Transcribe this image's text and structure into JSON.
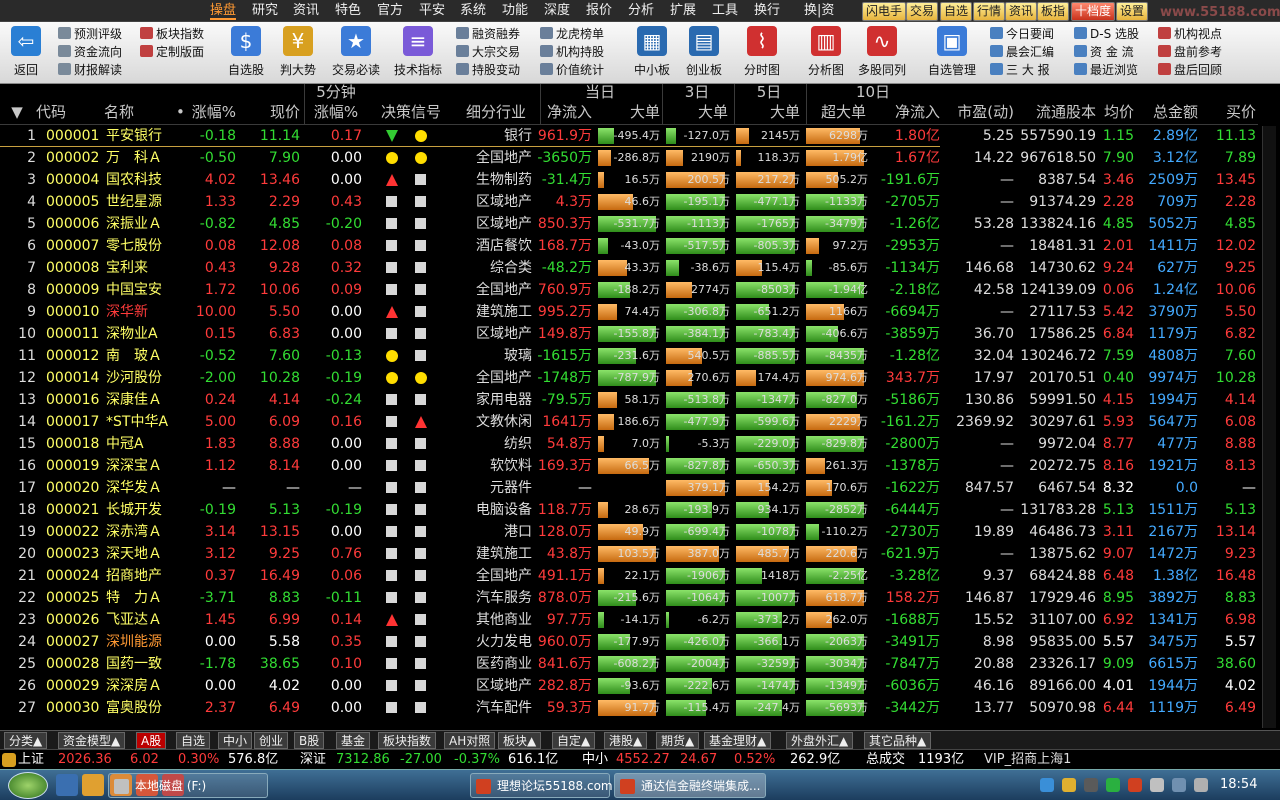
{
  "menu": {
    "items": [
      "操盘",
      "研究",
      "资讯",
      "特色",
      "官方",
      "平安",
      "系统",
      "功能",
      "深度",
      "报价",
      "分析",
      "扩展",
      "工具",
      "换行",
      "换|资"
    ],
    "active": 0,
    "right_buttons": [
      "闪电手",
      "交易",
      "自选",
      "行情",
      "资讯",
      "板指",
      "十档度",
      "设置"
    ]
  },
  "watermark": "www.55188.com",
  "toolbar": {
    "back": "返回",
    "small_groups": [
      [
        "预测评级",
        "资金流向",
        "财报解读"
      ],
      [
        "板块指数",
        "定制版面"
      ],
      [
        "融资融券",
        "大宗交易",
        "持股变动"
      ],
      [
        "龙虎榜单",
        "机构持股",
        "价值统计"
      ],
      [
        "今日要闻",
        "晨会汇编",
        "三 大 报"
      ],
      [
        "D-S 选股",
        "资 金 流",
        "最近浏览"
      ],
      [
        "机构视点",
        "盘前参考",
        "盘后回顾"
      ]
    ],
    "big": [
      "自选股",
      "判大势",
      "交易必读",
      "技术指标",
      "中小板",
      "创业板",
      "分时图",
      "分析图",
      "多股同列",
      "自选管理"
    ]
  },
  "headers": {
    "row1": {
      "today": "当日",
      "d3": "3日",
      "d5": "5日",
      "d10": "10日",
      "min5": "5分钟"
    },
    "row2": {
      "sel": "▼",
      "code": "代码",
      "name": "名称",
      "chg": "涨幅%",
      "price": "现价",
      "min5chg": "涨幅%",
      "signal": "决策信号",
      "industry": "细分行业",
      "netin": "净流入",
      "big1": "大单",
      "big3": "大单",
      "big5": "大单",
      "superbig": "超大单",
      "net10": "净流入",
      "pe": "市盈(动)",
      "float": "流通股本",
      "avgp": "均价",
      "amount": "总金额",
      "bid": "买价"
    },
    "name_dot": "•"
  },
  "colors": {
    "up": "#ff3b3b",
    "down": "#33dd33",
    "flat": "#ffffff",
    "code": "#ffff66",
    "name": "#ffff66",
    "blue": "#44aaff"
  },
  "rows": [
    {
      "n": "1",
      "code": "000001",
      "name": "平安银行",
      "chg": "-0.18",
      "price": "11.14",
      "m5": "0.17",
      "s1": "down",
      "s2": "dot",
      "ind": "银行",
      "net": "961.9万",
      "b1": "-495.4万",
      "b1v": 0.25,
      "b1c": "g",
      "b3": "-127.0万",
      "b3v": 0.15,
      "b3c": "g",
      "b5": "2145万",
      "b5v": 0.2,
      "b5c": "o",
      "sb": "6298万",
      "sbv": 0.85,
      "sbc": "o",
      "net10": "1.80亿",
      "pe": "5.25",
      "flt": "557590.19",
      "avg": "1.15",
      "amt": "2.89亿",
      "bid": "11.13"
    },
    {
      "n": "2",
      "code": "000002",
      "name": "万　科Ａ",
      "chg": "-0.50",
      "price": "7.90",
      "m5": "0.00",
      "s1": "dot",
      "s2": "dot",
      "ind": "全国地产",
      "net": "-3650万",
      "b1": "-286.8万",
      "b1v": 0.2,
      "b1c": "o",
      "b3": "2190万",
      "b3v": 0.25,
      "b3c": "o",
      "b5": "118.3万",
      "b5v": 0.08,
      "b5c": "o",
      "sb": "1.79亿",
      "sbv": 0.9,
      "sbc": "o",
      "net10": "1.67亿",
      "pe": "14.22",
      "flt": "967618.50",
      "avg": "7.90",
      "amt": "3.12亿",
      "bid": "7.89"
    },
    {
      "n": "3",
      "code": "000004",
      "name": "国农科技",
      "chg": "4.02",
      "price": "13.46",
      "m5": "0.00",
      "s1": "up",
      "s2": "sq",
      "ind": "生物制药",
      "net": "-31.4万",
      "b1": "16.5万",
      "b1v": 0.1,
      "b1c": "o",
      "b3": "200.5万",
      "b3v": 0.9,
      "b3c": "o",
      "b5": "217.2万",
      "b5v": 0.9,
      "b5c": "o",
      "sb": "505.2万",
      "sbv": 0.5,
      "sbc": "o",
      "net10": "-191.6万",
      "pe": "—",
      "flt": "8387.54",
      "avg": "3.46",
      "amt": "2509万",
      "bid": "13.45"
    },
    {
      "n": "4",
      "code": "000005",
      "name": "世纪星源",
      "chg": "1.33",
      "price": "2.29",
      "m5": "0.43",
      "s1": "sq",
      "s2": "sq",
      "ind": "区域地产",
      "net": "4.3万",
      "b1": "46.6万",
      "b1v": 0.55,
      "b1c": "o",
      "b3": "-195.1万",
      "b3v": 0.9,
      "b3c": "g",
      "b5": "-477.1万",
      "b5v": 0.9,
      "b5c": "g",
      "sb": "-1133万",
      "sbv": 0.9,
      "sbc": "g",
      "net10": "-2705万",
      "pe": "—",
      "flt": "91374.29",
      "avg": "2.28",
      "amt": "709万",
      "bid": "2.28"
    },
    {
      "n": "5",
      "code": "000006",
      "name": "深振业Ａ",
      "chg": "-0.82",
      "price": "4.85",
      "m5": "-0.20",
      "s1": "sq",
      "s2": "sq",
      "ind": "区域地产",
      "net": "850.3万",
      "b1": "-531.7万",
      "b1v": 0.9,
      "b1c": "g",
      "b3": "-1113万",
      "b3v": 0.9,
      "b3c": "g",
      "b5": "-1765万",
      "b5v": 0.9,
      "b5c": "g",
      "sb": "-3479万",
      "sbv": 0.9,
      "sbc": "g",
      "net10": "-1.26亿",
      "pe": "53.28",
      "flt": "133824.16",
      "avg": "4.85",
      "amt": "5052万",
      "bid": "4.85"
    },
    {
      "n": "6",
      "code": "000007",
      "name": "零七股份",
      "chg": "0.08",
      "price": "12.08",
      "m5": "0.08",
      "s1": "sq",
      "s2": "sq",
      "ind": "酒店餐饮",
      "net": "168.7万",
      "b1": "-43.0万",
      "b1v": 0.15,
      "b1c": "g",
      "b3": "-517.5万",
      "b3v": 0.9,
      "b3c": "g",
      "b5": "-805.3万",
      "b5v": 0.9,
      "b5c": "g",
      "sb": "97.2万",
      "sbv": 0.2,
      "sbc": "o",
      "net10": "-2953万",
      "pe": "—",
      "flt": "18481.31",
      "avg": "2.01",
      "amt": "1411万",
      "bid": "12.02"
    },
    {
      "n": "7",
      "code": "000008",
      "name": "宝利来",
      "chg": "0.43",
      "price": "9.28",
      "m5": "0.32",
      "s1": "sq",
      "s2": "sq",
      "ind": "综合类",
      "net": "-48.2万",
      "b1": "43.3万",
      "b1v": 0.45,
      "b1c": "o",
      "b3": "-38.6万",
      "b3v": 0.2,
      "b3c": "g",
      "b5": "115.4万",
      "b5v": 0.4,
      "b5c": "o",
      "sb": "-85.6万",
      "sbv": 0.1,
      "sbc": "g",
      "net10": "-1134万",
      "pe": "146.68",
      "flt": "14730.62",
      "avg": "9.24",
      "amt": "627万",
      "bid": "9.25"
    },
    {
      "n": "8",
      "code": "000009",
      "name": "中国宝安",
      "chg": "1.72",
      "price": "10.06",
      "m5": "0.09",
      "s1": "sq",
      "s2": "sq",
      "ind": "全国地产",
      "net": "760.9万",
      "b1": "-188.2万",
      "b1v": 0.5,
      "b1c": "g",
      "b3": "2774万",
      "b3v": 0.4,
      "b3c": "o",
      "b5": "-8503万",
      "b5v": 0.9,
      "b5c": "g",
      "sb": "-1.94亿",
      "sbv": 0.9,
      "sbc": "g",
      "net10": "-2.18亿",
      "pe": "42.58",
      "flt": "124139.09",
      "avg": "0.06",
      "amt": "1.24亿",
      "bid": "10.06"
    },
    {
      "n": "9",
      "code": "000010",
      "name": "深华新",
      "chg": "10.00",
      "price": "5.50",
      "m5": "0.00",
      "s1": "up",
      "s2": "sq",
      "ind": "建筑施工",
      "net": "995.2万",
      "b1": "74.4万",
      "b1v": 0.3,
      "b1c": "o",
      "b3": "-306.8万",
      "b3v": 0.9,
      "b3c": "g",
      "b5": "-651.2万",
      "b5v": 0.5,
      "b5c": "g",
      "sb": "1166万",
      "sbv": 0.6,
      "sbc": "o",
      "net10": "-6694万",
      "pe": "—",
      "flt": "27117.53",
      "avg": "5.42",
      "amt": "3790万",
      "bid": "5.50"
    },
    {
      "n": "10",
      "code": "000011",
      "name": "深物业A",
      "chg": "0.15",
      "price": "6.83",
      "m5": "0.00",
      "s1": "sq",
      "s2": "sq",
      "ind": "区域地产",
      "net": "149.8万",
      "b1": "-155.8万",
      "b1v": 0.9,
      "b1c": "g",
      "b3": "-384.1万",
      "b3v": 0.9,
      "b3c": "g",
      "b5": "-783.4万",
      "b5v": 0.9,
      "b5c": "g",
      "sb": "-406.6万",
      "sbv": 0.5,
      "sbc": "g",
      "net10": "-3859万",
      "pe": "36.70",
      "flt": "17586.25",
      "avg": "6.84",
      "amt": "1179万",
      "bid": "6.82"
    },
    {
      "n": "11",
      "code": "000012",
      "name": "南　玻Ａ",
      "chg": "-0.52",
      "price": "7.60",
      "m5": "-0.13",
      "s1": "dot",
      "s2": "sq",
      "ind": "玻璃",
      "net": "-1615万",
      "b1": "-231.6万",
      "b1v": 0.6,
      "b1c": "g",
      "b3": "540.5万",
      "b3v": 0.55,
      "b3c": "o",
      "b5": "-885.5万",
      "b5v": 0.9,
      "b5c": "g",
      "sb": "-8435万",
      "sbv": 0.9,
      "sbc": "g",
      "net10": "-1.28亿",
      "pe": "32.04",
      "flt": "130246.72",
      "avg": "7.59",
      "amt": "4808万",
      "bid": "7.60"
    },
    {
      "n": "12",
      "code": "000014",
      "name": "沙河股份",
      "chg": "-2.00",
      "price": "10.28",
      "m5": "-0.19",
      "s1": "dot",
      "s2": "dot",
      "ind": "全国地产",
      "net": "-1748万",
      "b1": "-787.9万",
      "b1v": 0.9,
      "b1c": "g",
      "b3": "270.6万",
      "b3v": 0.4,
      "b3c": "o",
      "b5": "174.4万",
      "b5v": 0.3,
      "b5c": "o",
      "sb": "974.6万",
      "sbv": 0.9,
      "sbc": "o",
      "net10": "343.7万",
      "pe": "17.97",
      "flt": "20170.51",
      "avg": "0.40",
      "amt": "9974万",
      "bid": "10.28"
    },
    {
      "n": "13",
      "code": "000016",
      "name": "深康佳Ａ",
      "chg": "0.24",
      "price": "4.14",
      "m5": "-0.24",
      "s1": "sq",
      "s2": "sq",
      "ind": "家用电器",
      "net": "-79.5万",
      "b1": "58.1万",
      "b1v": 0.3,
      "b1c": "o",
      "b3": "-513.8万",
      "b3v": 0.9,
      "b3c": "g",
      "b5": "-1347万",
      "b5v": 0.9,
      "b5c": "g",
      "sb": "-827.0万",
      "sbv": 0.8,
      "sbc": "g",
      "net10": "-5186万",
      "pe": "130.86",
      "flt": "59991.50",
      "avg": "4.15",
      "amt": "1994万",
      "bid": "4.14"
    },
    {
      "n": "14",
      "code": "000017",
      "name": "*ST中华A",
      "chg": "5.00",
      "price": "6.09",
      "m5": "0.16",
      "s1": "sq",
      "s2": "up",
      "ind": "文教休闲",
      "net": "1641万",
      "b1": "186.6万",
      "b1v": 0.25,
      "b1c": "o",
      "b3": "-477.9万",
      "b3v": 0.9,
      "b3c": "g",
      "b5": "-599.6万",
      "b5v": 0.9,
      "b5c": "g",
      "sb": "2229万",
      "sbv": 0.85,
      "sbc": "o",
      "net10": "-161.2万",
      "pe": "2369.92",
      "flt": "30297.61",
      "avg": "5.93",
      "amt": "5647万",
      "bid": "6.08"
    },
    {
      "n": "15",
      "code": "000018",
      "name": "中冠A",
      "chg": "1.83",
      "price": "8.88",
      "m5": "0.00",
      "s1": "sq",
      "s2": "sq",
      "ind": "纺织",
      "net": "54.8万",
      "b1": "7.0万",
      "b1v": 0.1,
      "b1c": "o",
      "b3": "-5.3万",
      "b3v": 0.05,
      "b3c": "g",
      "b5": "-229.0万",
      "b5v": 0.9,
      "b5c": "g",
      "sb": "-829.8万",
      "sbv": 0.9,
      "sbc": "g",
      "net10": "-2800万",
      "pe": "—",
      "flt": "9972.04",
      "avg": "8.77",
      "amt": "477万",
      "bid": "8.88"
    },
    {
      "n": "16",
      "code": "000019",
      "name": "深深宝Ａ",
      "chg": "1.12",
      "price": "8.14",
      "m5": "0.00",
      "s1": "sq",
      "s2": "sq",
      "ind": "软饮料",
      "net": "169.3万",
      "b1": "66.5万",
      "b1v": 0.8,
      "b1c": "o",
      "b3": "-827.8万",
      "b3v": 0.9,
      "b3c": "g",
      "b5": "-650.3万",
      "b5v": 0.9,
      "b5c": "g",
      "sb": "261.3万",
      "sbv": 0.3,
      "sbc": "o",
      "net10": "-1378万",
      "pe": "—",
      "flt": "20272.75",
      "avg": "8.16",
      "amt": "1921万",
      "bid": "8.13"
    },
    {
      "n": "17",
      "code": "000020",
      "name": "深华发Ａ",
      "chg": "—",
      "price": "—",
      "m5": "—",
      "s1": "sq",
      "s2": "sq",
      "ind": "元器件",
      "net": "—",
      "b1": "",
      "b1v": 0,
      "b1c": "o",
      "b3": "379.1万",
      "b3v": 0.9,
      "b3c": "o",
      "b5": "154.2万",
      "b5v": 0.5,
      "b5c": "o",
      "sb": "170.6万",
      "sbv": 0.4,
      "sbc": "o",
      "net10": "-1622万",
      "pe": "847.57",
      "flt": "6467.54",
      "avg": "8.32",
      "amt": "0.0",
      "bid": "—"
    },
    {
      "n": "18",
      "code": "000021",
      "name": "长城开发",
      "chg": "-0.19",
      "price": "5.13",
      "m5": "-0.19",
      "s1": "sq",
      "s2": "sq",
      "ind": "电脑设备",
      "net": "118.7万",
      "b1": "28.6万",
      "b1v": 0.15,
      "b1c": "o",
      "b3": "-193.9万",
      "b3v": 0.7,
      "b3c": "g",
      "b5": "934.1万",
      "b5v": 0.5,
      "b5c": "g",
      "sb": "-2852万",
      "sbv": 0.9,
      "sbc": "g",
      "net10": "-6444万",
      "pe": "—",
      "flt": "131783.28",
      "avg": "5.13",
      "amt": "1511万",
      "bid": "5.13"
    },
    {
      "n": "19",
      "code": "000022",
      "name": "深赤湾Ａ",
      "chg": "3.14",
      "price": "13.15",
      "m5": "0.00",
      "s1": "sq",
      "s2": "sq",
      "ind": "港口",
      "net": "128.0万",
      "b1": "49.9万",
      "b1v": 0.7,
      "b1c": "o",
      "b3": "-699.4万",
      "b3v": 0.9,
      "b3c": "g",
      "b5": "-1078万",
      "b5v": 0.9,
      "b5c": "g",
      "sb": "-110.2万",
      "sbv": 0.2,
      "sbc": "g",
      "net10": "-2730万",
      "pe": "19.89",
      "flt": "46486.73",
      "avg": "3.11",
      "amt": "2167万",
      "bid": "13.14"
    },
    {
      "n": "20",
      "code": "000023",
      "name": "深天地Ａ",
      "chg": "3.12",
      "price": "9.25",
      "m5": "0.76",
      "s1": "sq",
      "s2": "sq",
      "ind": "建筑施工",
      "net": "43.8万",
      "b1": "103.5万",
      "b1v": 0.9,
      "b1c": "o",
      "b3": "387.0万",
      "b3v": 0.8,
      "b3c": "o",
      "b5": "485.7万",
      "b5v": 0.8,
      "b5c": "o",
      "sb": "220.6万",
      "sbv": 0.8,
      "sbc": "o",
      "net10": "-621.9万",
      "pe": "—",
      "flt": "13875.62",
      "avg": "9.07",
      "amt": "1472万",
      "bid": "9.23"
    },
    {
      "n": "21",
      "code": "000024",
      "name": "招商地产",
      "chg": "0.37",
      "price": "16.49",
      "m5": "0.06",
      "s1": "sq",
      "s2": "sq",
      "ind": "全国地产",
      "net": "491.1万",
      "b1": "22.1万",
      "b1v": 0.1,
      "b1c": "o",
      "b3": "-1906万",
      "b3v": 0.9,
      "b3c": "g",
      "b5": "1418万",
      "b5v": 0.4,
      "b5c": "g",
      "sb": "-2.25亿",
      "sbv": 0.9,
      "sbc": "g",
      "net10": "-3.28亿",
      "pe": "9.37",
      "flt": "68424.88",
      "avg": "6.48",
      "amt": "1.38亿",
      "bid": "16.48"
    },
    {
      "n": "22",
      "code": "000025",
      "name": "特　力Ａ",
      "chg": "-3.71",
      "price": "8.83",
      "m5": "-0.11",
      "s1": "sq",
      "s2": "sq",
      "ind": "汽车服务",
      "net": "878.0万",
      "b1": "-215.6万",
      "b1v": 0.6,
      "b1c": "g",
      "b3": "-1064万",
      "b3v": 0.9,
      "b3c": "g",
      "b5": "-1007万",
      "b5v": 0.9,
      "b5c": "g",
      "sb": "618.7万",
      "sbv": 0.9,
      "sbc": "o",
      "net10": "158.2万",
      "pe": "146.87",
      "flt": "17929.46",
      "avg": "8.95",
      "amt": "3892万",
      "bid": "8.83"
    },
    {
      "n": "23",
      "code": "000026",
      "name": "飞亚达Ａ",
      "chg": "1.45",
      "price": "6.99",
      "m5": "0.14",
      "s1": "up",
      "s2": "sq",
      "ind": "其他商业",
      "net": "97.7万",
      "b1": "-14.1万",
      "b1v": 0.1,
      "b1c": "g",
      "b3": "-6.2万",
      "b3v": 0.05,
      "b3c": "g",
      "b5": "-373.2万",
      "b5v": 0.7,
      "b5c": "g",
      "sb": "262.0万",
      "sbv": 0.4,
      "sbc": "o",
      "net10": "-1688万",
      "pe": "15.52",
      "flt": "31107.00",
      "avg": "6.92",
      "amt": "1341万",
      "bid": "6.98"
    },
    {
      "n": "24",
      "code": "000027",
      "name": "深圳能源",
      "chg": "0.00",
      "price": "5.58",
      "m5": "0.35",
      "s1": "sq",
      "s2": "sq",
      "ind": "火力发电",
      "net": "960.0万",
      "b1": "-177.9万",
      "b1v": 0.5,
      "b1c": "g",
      "b3": "-426.0万",
      "b3v": 0.9,
      "b3c": "g",
      "b5": "-366.1万",
      "b5v": 0.7,
      "b5c": "g",
      "sb": "-2063万",
      "sbv": 0.9,
      "sbc": "g",
      "net10": "-3491万",
      "pe": "8.98",
      "flt": "95835.00",
      "avg": "5.57",
      "amt": "3475万",
      "bid": "5.57"
    },
    {
      "n": "25",
      "code": "000028",
      "name": "国药一致",
      "chg": "-1.78",
      "price": "38.65",
      "m5": "0.10",
      "s1": "sq",
      "s2": "sq",
      "ind": "医药商业",
      "net": "841.6万",
      "b1": "-608.2万",
      "b1v": 0.9,
      "b1c": "g",
      "b3": "-2004万",
      "b3v": 0.9,
      "b3c": "g",
      "b5": "-3259万",
      "b5v": 0.9,
      "b5c": "g",
      "sb": "-3034万",
      "sbv": 0.9,
      "sbc": "g",
      "net10": "-7847万",
      "pe": "20.88",
      "flt": "23326.17",
      "avg": "9.09",
      "amt": "6615万",
      "bid": "38.60"
    },
    {
      "n": "26",
      "code": "000029",
      "name": "深深房Ａ",
      "chg": "0.00",
      "price": "4.02",
      "m5": "0.00",
      "s1": "sq",
      "s2": "sq",
      "ind": "区域地产",
      "net": "282.8万",
      "b1": "-93.6万",
      "b1v": 0.5,
      "b1c": "g",
      "b3": "-222.6万",
      "b3v": 0.7,
      "b3c": "g",
      "b5": "-1474万",
      "b5v": 0.9,
      "b5c": "g",
      "sb": "-1349万",
      "sbv": 0.9,
      "sbc": "g",
      "net10": "-6036万",
      "pe": "46.16",
      "flt": "89166.00",
      "avg": "4.01",
      "amt": "1944万",
      "bid": "4.02"
    },
    {
      "n": "27",
      "code": "000030",
      "name": "富奥股份",
      "chg": "2.37",
      "price": "6.49",
      "m5": "0.00",
      "s1": "sq",
      "s2": "sq",
      "ind": "汽车配件",
      "net": "59.3万",
      "b1": "91.7万",
      "b1v": 0.9,
      "b1c": "o",
      "b3": "-115.4万",
      "b3v": 0.6,
      "b3c": "g",
      "b5": "-247.4万",
      "b5v": 0.7,
      "b5c": "g",
      "sb": "-5693万",
      "sbv": 0.9,
      "sbc": "g",
      "net10": "-3442万",
      "pe": "13.77",
      "flt": "50970.98",
      "avg": "6.44",
      "amt": "1119万",
      "bid": "6.49"
    }
  ],
  "tabs": [
    "分类▲",
    "资金模型▲",
    "A股",
    "自选",
    "中小",
    "创业",
    "B股",
    "基金",
    "板块指数",
    "AH对照",
    "板块▲",
    "自定▲",
    "港股▲",
    "期货▲",
    "基金理财▲",
    "外盘外汇▲",
    "其它品种▲"
  ],
  "tabs_active": 2,
  "status": {
    "sh_label": "上证",
    "sh_idx": "2026.36",
    "sh_chg": "6.02",
    "sh_pct": "0.30%",
    "sh_amt": "576.8亿",
    "sz_label": "深证",
    "sz_idx": "7312.86",
    "sz_chg": "-27.00",
    "sz_pct": "-0.37%",
    "sz_amt": "616.1亿",
    "zx_label": "中小",
    "zx_idx": "4552.27",
    "zx_chg": "24.67",
    "zx_pct": "0.52%",
    "zx_amt": "262.9亿",
    "total_label": "总成交",
    "total": "1193亿",
    "broker": "VIP_招商上海1"
  },
  "taskbar": {
    "tasks": [
      "本地磁盘 (F:)",
      "理想论坛55188.com",
      "通达信金融终端集成..."
    ],
    "clock": "18:54"
  }
}
